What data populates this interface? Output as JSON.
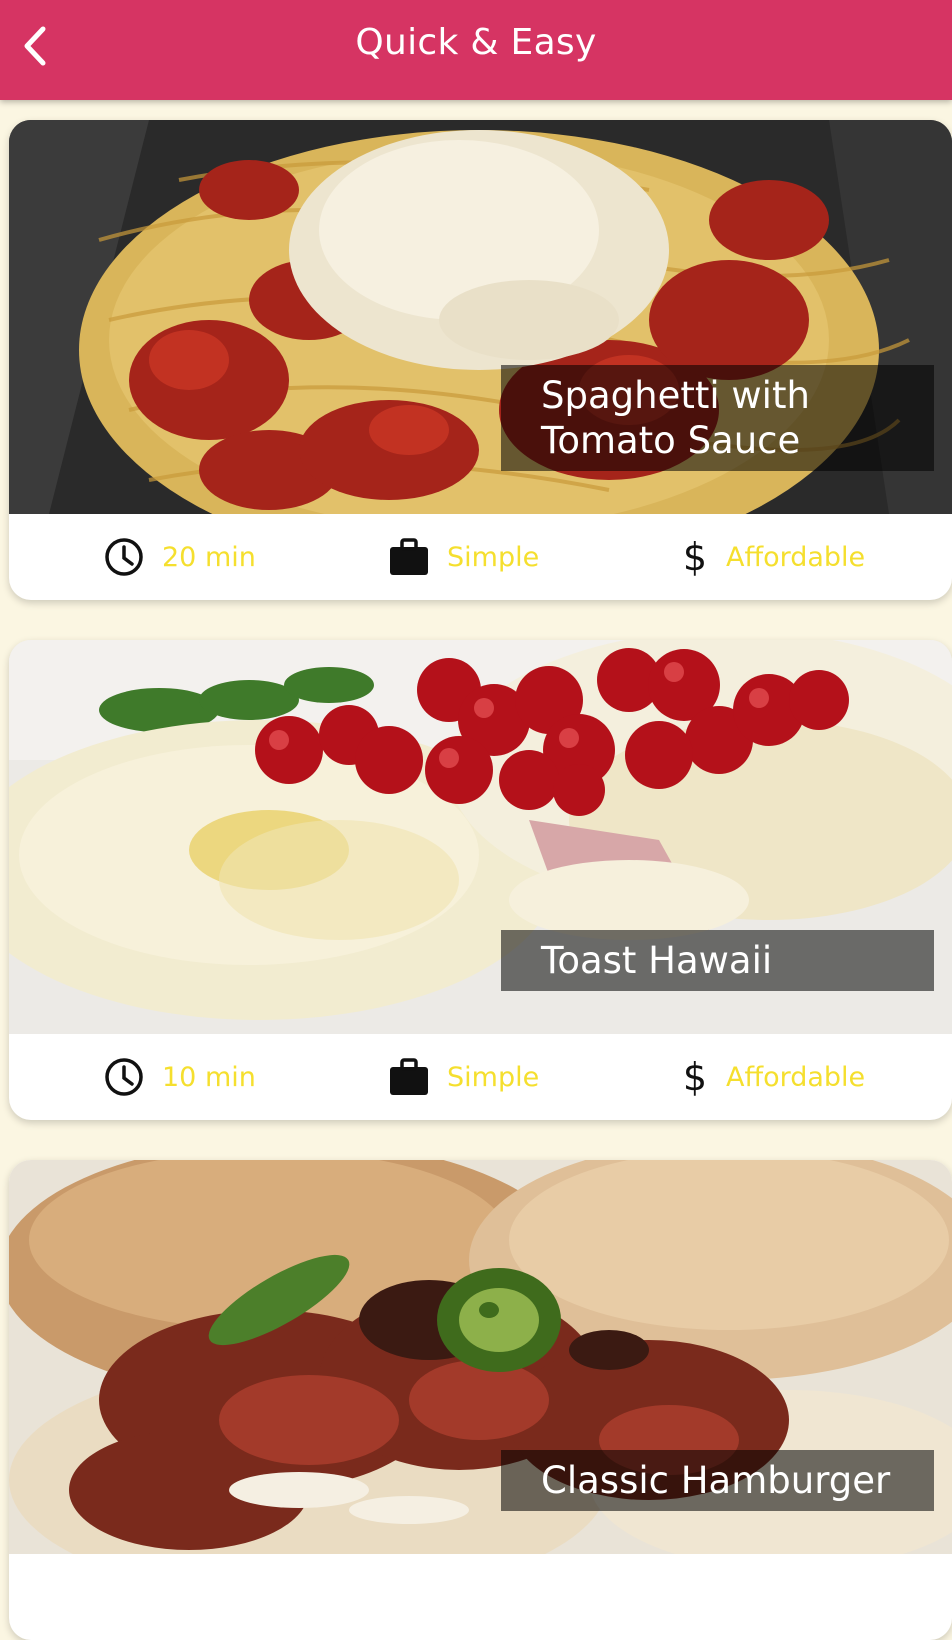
{
  "appbar": {
    "title": "Quick & Easy",
    "back_icon": "chevron-left-icon"
  },
  "colors": {
    "primary": "#d63463",
    "accent": "#f5df2e",
    "background": "#fbf6e2"
  },
  "meals": [
    {
      "title": "Spaghetti with Tomato Sauce",
      "duration": "20 min",
      "complexity": "Simple",
      "affordability": "Affordable"
    },
    {
      "title": "Toast Hawaii",
      "duration": "10 min",
      "complexity": "Simple",
      "affordability": "Affordable"
    },
    {
      "title": "Classic Hamburger"
    }
  ],
  "icons": {
    "duration": "clock-icon",
    "complexity": "briefcase-icon",
    "affordability": "dollar-icon"
  }
}
